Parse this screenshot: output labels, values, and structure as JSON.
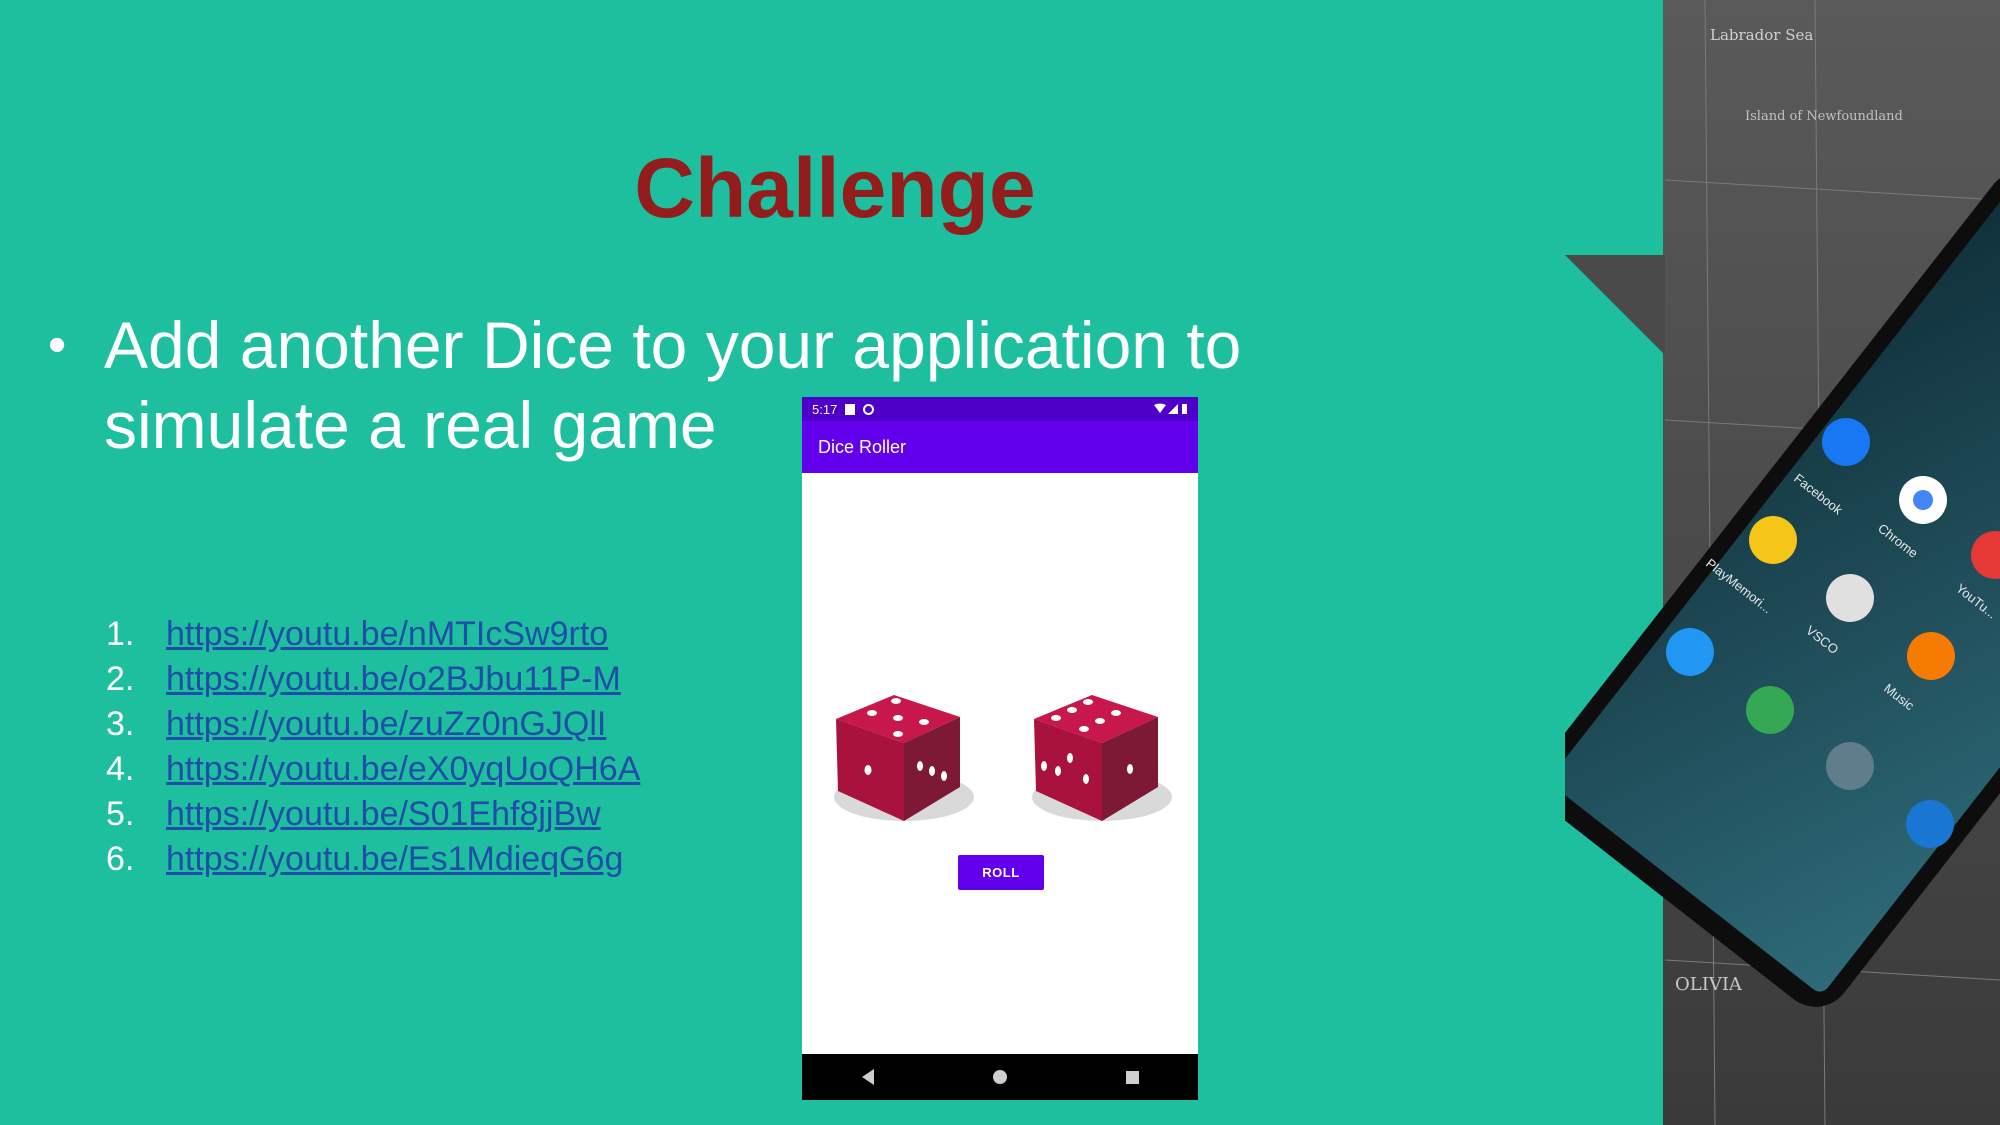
{
  "slide": {
    "title": "Challenge",
    "bullet": "Add another Dice to your application to simulate a real game"
  },
  "links": [
    {
      "number": "1.",
      "url": "https://youtu.be/nMTIcSw9rto"
    },
    {
      "number": "2.",
      "url": "https://youtu.be/o2BJbu11P-M"
    },
    {
      "number": "3.",
      "url": "https://youtu.be/zuZz0nGJQlI"
    },
    {
      "number": "4.",
      "url": "https://youtu.be/eX0yqUoQH6A"
    },
    {
      "number": "5.",
      "url": "https://youtu.be/S01Ehf8jjBw"
    },
    {
      "number": "6.",
      "url": "https://youtu.be/Es1MdieqG6g"
    }
  ],
  "phone": {
    "status_time": "5:17",
    "app_title": "Dice Roller",
    "roll_label": "ROLL"
  },
  "deco": {
    "app_labels": [
      "Facebook",
      "Chrome",
      "PlayMemori...",
      "VSCO",
      "Music",
      "YouTu..."
    ],
    "map_labels": [
      "Labrador Sea",
      "Island of Newfoundland",
      "OLIVIA"
    ]
  },
  "colors": {
    "background": "#1dbf9f",
    "title": "#931c1c",
    "link": "#1f4ea8",
    "app_bar": "#6200ee",
    "dice": "#b0173f"
  }
}
